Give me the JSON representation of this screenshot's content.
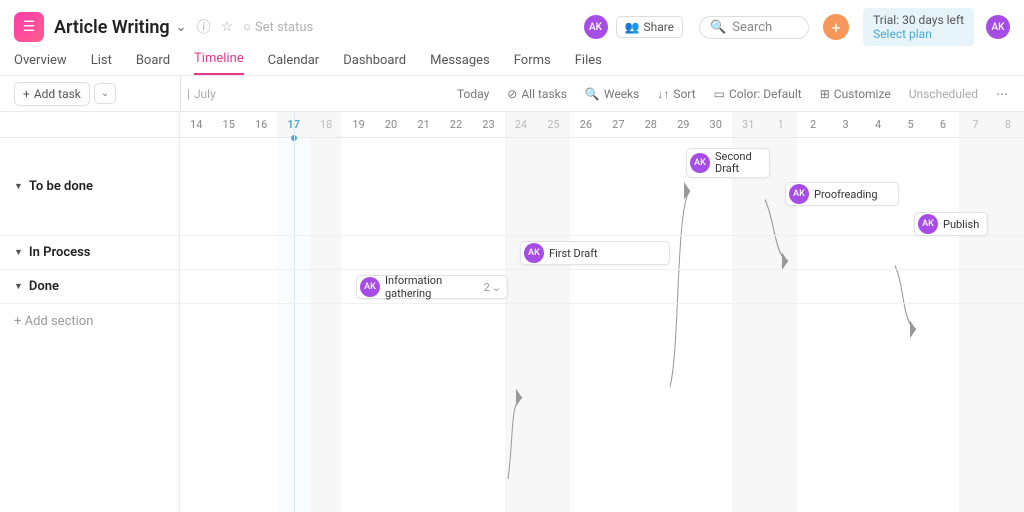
{
  "header": {
    "project_title": "Article Writing",
    "set_status": "Set status",
    "share": "Share",
    "search_placeholder": "Search",
    "trial_line1": "Trial: 30 days left",
    "trial_line2": "Select plan",
    "avatar": "AK"
  },
  "tabs": {
    "overview": "Overview",
    "list": "List",
    "board": "Board",
    "timeline": "Timeline",
    "calendar": "Calendar",
    "dashboard": "Dashboard",
    "messages": "Messages",
    "forms": "Forms",
    "files": "Files"
  },
  "toolbar": {
    "add_task": "Add task",
    "month": "July",
    "today": "Today",
    "all_tasks": "All tasks",
    "weeks": "Weeks",
    "sort": "Sort",
    "color": "Color: Default",
    "customize": "Customize",
    "unscheduled": "Unscheduled"
  },
  "dates": [
    "14",
    "15",
    "16",
    "17",
    "18",
    "19",
    "20",
    "21",
    "22",
    "23",
    "24",
    "25",
    "26",
    "27",
    "28",
    "29",
    "30",
    "31",
    "1",
    "2",
    "3",
    "4",
    "5",
    "6",
    "7",
    "8"
  ],
  "date_flags": {
    "today_index": 3,
    "weekend_indices": [
      3,
      4,
      10,
      11,
      17,
      18,
      24,
      25
    ]
  },
  "sections": {
    "to_be_done": "To be done",
    "in_process": "In Process",
    "done": "Done",
    "add_section": "+ Add section"
  },
  "tasks": {
    "second_draft": {
      "label": "Second\nDraft",
      "assignee": "AK"
    },
    "proofreading": {
      "label": "Proofreading",
      "assignee": "AK"
    },
    "publish": {
      "label": "Publish",
      "assignee": "AK"
    },
    "first_draft": {
      "label": "First Draft",
      "assignee": "AK"
    },
    "info_gathering": {
      "label": "Information gathering",
      "assignee": "AK",
      "subtasks": "2"
    }
  },
  "colors": {
    "accent": "#e5368d",
    "avatar": "#a64de6",
    "plus": "#f7975a",
    "today": "#4aa7d6"
  }
}
